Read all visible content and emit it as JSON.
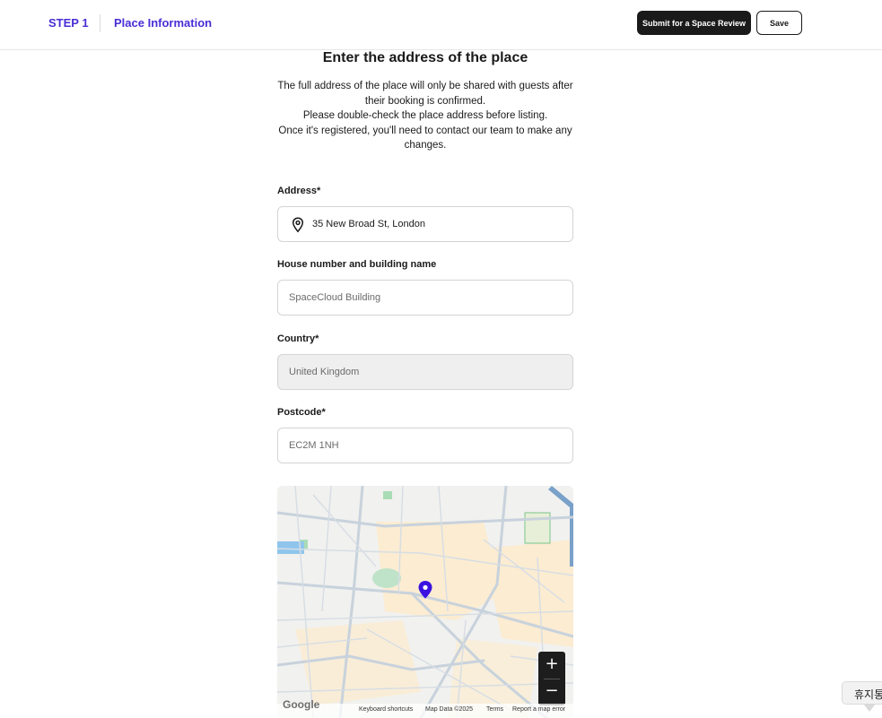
{
  "header": {
    "step": "STEP 1",
    "title": "Place Information",
    "submit_label": "Submit for a Space Review",
    "save_label": "Save"
  },
  "main": {
    "heading": "Enter the address of the place",
    "description": [
      "The full address of the place will only be shared with guests after their booking is confirmed.",
      "Please double-check the place address before listing.",
      "Once it's registered, you'll need to contact our team to make any changes."
    ]
  },
  "form": {
    "address": {
      "label": "Address*",
      "value": "35 New Broad St, London"
    },
    "building": {
      "label": "House number and building name",
      "placeholder": "SpaceCloud Building"
    },
    "country": {
      "label": "Country*",
      "value": "United Kingdom"
    },
    "postcode": {
      "label": "Postcode*",
      "placeholder": "EC2M 1NH"
    }
  },
  "map": {
    "zoom_in": "+",
    "zoom_out": "−",
    "logo": "Google",
    "attribution": {
      "shortcuts": "Keyboard shortcuts",
      "map_data": "Map Data ©2025",
      "terms": "Terms",
      "report": "Report a map error"
    },
    "marker_color": "#3a12e0"
  },
  "chat_widget": {
    "label": "휴지통"
  },
  "colors": {
    "accent": "#4a2dd6",
    "dark": "#1a1a1a"
  }
}
